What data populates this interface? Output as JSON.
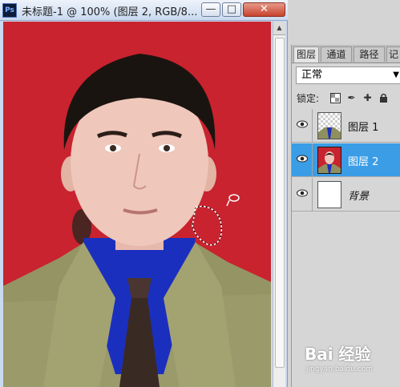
{
  "document": {
    "title": "未标题-1 @ 100% (图层 2, RGB/8...",
    "app_icon": "Ps",
    "minimize_icon": "minimize-icon",
    "restore_icon": "restore-icon",
    "close_icon": "close-icon"
  },
  "layers_panel": {
    "tabs": [
      {
        "label": "图层",
        "active": true
      },
      {
        "label": "通道",
        "active": false
      },
      {
        "label": "路径",
        "active": false
      },
      {
        "label": "记",
        "active": false
      }
    ],
    "blend_mode": "正常",
    "lock_label": "锁定:",
    "lock_icons": [
      "lock-transparency-icon",
      "lock-paint-icon",
      "lock-position-icon",
      "lock-all-icon"
    ],
    "layers": [
      {
        "name": "图层 1",
        "visible": true,
        "selected": false,
        "thumb": "transparent-with-suit"
      },
      {
        "name": "图层 2",
        "visible": true,
        "selected": true,
        "thumb": "portrait-red-bg"
      },
      {
        "name": "背景",
        "visible": true,
        "selected": false,
        "thumb": "white"
      }
    ]
  },
  "watermark": {
    "brand": "Bai 经验",
    "url": "jingyan.baidu.com"
  },
  "colors": {
    "background_red": "#c8232f",
    "selected_layer": "#3a9de6",
    "suit": "#9a9a6a",
    "shirt": "#1b2fbf"
  }
}
